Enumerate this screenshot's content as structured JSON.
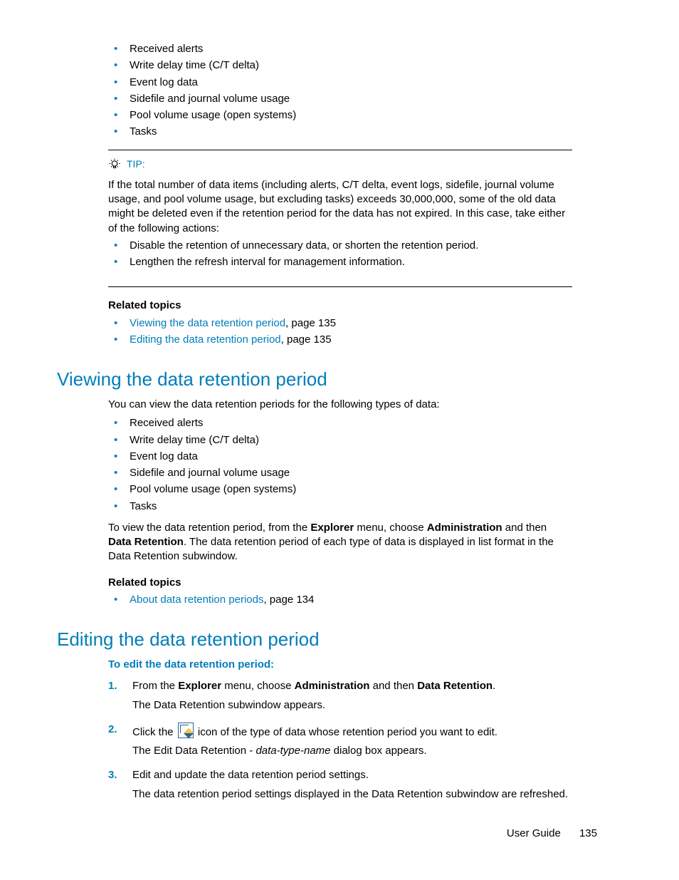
{
  "intro_bullets": [
    "Received alerts",
    "Write delay time (C/T delta)",
    "Event log data",
    "Sidefile and journal volume usage",
    "Pool volume usage (open systems)",
    "Tasks"
  ],
  "tip": {
    "label": "TIP:",
    "text": "If the total number of data items (including alerts, C/T delta, event logs, sidefile, journal volume usage, and pool volume usage, but excluding tasks) exceeds 30,000,000, some of the old data might be deleted even if the retention period for the data has not expired. In this case, take either of the following actions:",
    "bullets": [
      "Disable the retention of unnecessary data, or shorten the retention period.",
      "Lengthen the refresh interval for management information."
    ]
  },
  "related1": {
    "label": "Related topics",
    "items": [
      {
        "link": "Viewing the data retention period",
        "suffix": ", page 135"
      },
      {
        "link": "Editing the data retention period",
        "suffix": ", page 135"
      }
    ]
  },
  "section_view": {
    "title": "Viewing the data retention period",
    "intro": "You can view the data retention periods for the following types of data:",
    "bullets": [
      "Received alerts",
      "Write delay time (C/T delta)",
      "Event log data",
      "Sidefile and journal volume usage",
      "Pool volume usage (open systems)",
      "Tasks"
    ],
    "p2_parts": {
      "a": "To view the data retention period, from the ",
      "b": "Explorer",
      "c": " menu, choose ",
      "d": "Administration",
      "e": " and then ",
      "f": "Data Retention",
      "g": ". The data retention period of each type of data is displayed in list format in the Data Retention subwindow."
    }
  },
  "related2": {
    "label": "Related topics",
    "items": [
      {
        "link": "About data retention periods",
        "suffix": ", page 134"
      }
    ]
  },
  "section_edit": {
    "title": "Editing the data retention period",
    "proc_title": "To edit the data retention period:",
    "steps": {
      "s1": {
        "a": "From the ",
        "b": "Explorer",
        "c": " menu, choose ",
        "d": "Administration",
        "e": " and then ",
        "f": "Data Retention",
        "g": ".",
        "sub": "The Data Retention subwindow appears."
      },
      "s2": {
        "a": "Click the ",
        "b": " icon of the type of data whose retention period you want to edit.",
        "sub_a": "The Edit Data Retention - ",
        "sub_i": "data-type-name",
        "sub_b": " dialog box appears."
      },
      "s3": {
        "a": "Edit and update the data retention period settings.",
        "sub": "The data retention period settings displayed in the Data Retention subwindow are refreshed."
      }
    }
  },
  "footer": {
    "doc": "User Guide",
    "page": "135"
  }
}
